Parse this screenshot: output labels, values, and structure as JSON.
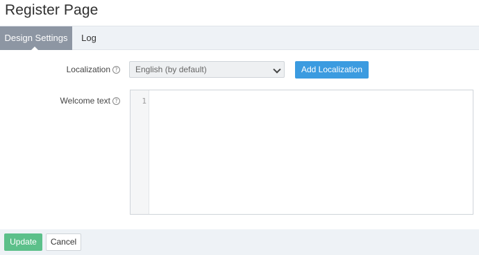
{
  "page": {
    "title": "Register Page"
  },
  "tabs": [
    {
      "label": "Design Settings",
      "active": true
    },
    {
      "label": "Log",
      "active": false
    }
  ],
  "form": {
    "localization": {
      "label": "Localization",
      "help_icon": "question-circle",
      "selected": "English (by default)",
      "add_button": "Add Localization"
    },
    "welcome_text": {
      "label": "Welcome text",
      "help_icon": "question-circle",
      "line_number": "1",
      "value": ""
    }
  },
  "footer": {
    "update_label": "Update",
    "cancel_label": "Cancel"
  },
  "colors": {
    "primary": "#3b9be0",
    "success": "#5cc08a",
    "active_tab": "#8d96a3"
  }
}
